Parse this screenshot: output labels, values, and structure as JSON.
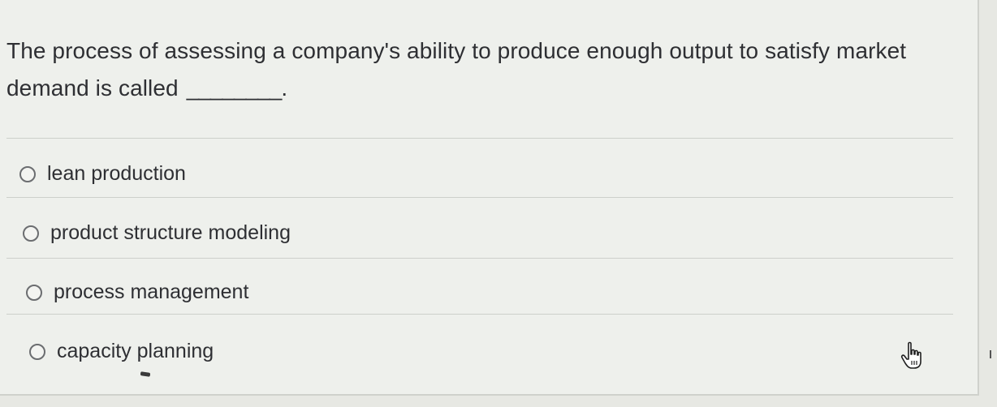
{
  "question": {
    "text": "The process of assessing a company's ability to produce enough output to satisfy market demand is called",
    "blank": "________."
  },
  "options": [
    {
      "label": "lean production",
      "selected": false
    },
    {
      "label": "product structure modeling",
      "selected": false
    },
    {
      "label": "process management",
      "selected": false
    },
    {
      "label": "capacity planning",
      "selected": false
    }
  ],
  "icons": {
    "cursor": "hand-pointer-icon",
    "radio": "radio-button-icon"
  }
}
